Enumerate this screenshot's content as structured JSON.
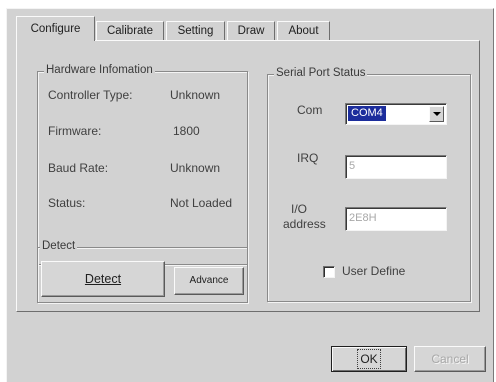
{
  "tabs": [
    "Configure",
    "Calibrate",
    "Setting",
    "Draw",
    "About"
  ],
  "hardware": {
    "title": "Hardware Infomation",
    "controller_type_label": "Controller Type:",
    "controller_type_value": "Unknown",
    "firmware_label": "Firmware:",
    "firmware_value": "1800",
    "baud_rate_label": "Baud Rate:",
    "baud_rate_value": "Unknown",
    "status_label": "Status:",
    "status_value": "Not Loaded"
  },
  "detect": {
    "title": "Detect",
    "detect_button": "Detect",
    "advance_button": "Advance"
  },
  "serial": {
    "title": "Serial Port Status",
    "com_label": "Com",
    "com_value": "COM4",
    "irq_label": "IRQ",
    "irq_value": "5",
    "io_label_line1": "I/O",
    "io_label_line2": "address",
    "io_value": "2E8H",
    "user_define_label": "User Define",
    "user_define_checked": false
  },
  "footer": {
    "ok_button": "OK",
    "cancel_button": "Cancel"
  }
}
